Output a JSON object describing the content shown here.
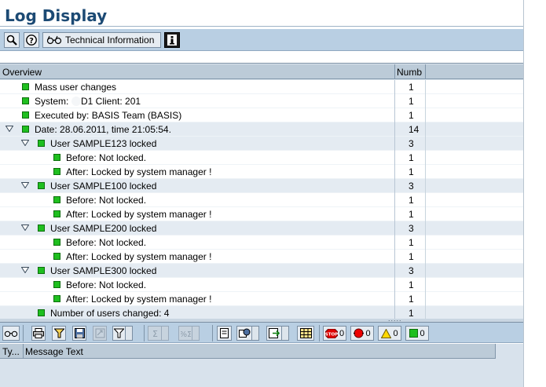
{
  "window": {
    "title": "Log Display"
  },
  "toolbar": {
    "technical_information_label": "Technical Information",
    "icons": [
      "find-icon",
      "help-icon",
      "glasses-icon",
      "info-icon"
    ]
  },
  "tree": {
    "columns": {
      "overview": "Overview",
      "number": "Numb"
    },
    "rows": [
      {
        "label": "Mass user changes",
        "count": "1",
        "level": 0,
        "expandable": false,
        "status": "green"
      },
      {
        "label": "System: ",
        "label_tail": "D1 Client: 201",
        "count": "1",
        "level": 0,
        "expandable": false,
        "status": "green"
      },
      {
        "label": "Executed by: BASIS Team (BASIS)",
        "count": "1",
        "level": 0,
        "expandable": false,
        "status": "green"
      },
      {
        "label": "Date: 28.06.2011, time 21:05:54.",
        "count": "14",
        "level": 0,
        "expandable": true,
        "status": "green"
      },
      {
        "label": "User SAMPLE123 locked",
        "count": "3",
        "level": 1,
        "expandable": true,
        "status": "green"
      },
      {
        "label": "Before:  Not locked.",
        "count": "1",
        "level": 2,
        "expandable": false,
        "status": "green"
      },
      {
        "label": "After:  Locked by system manager !",
        "count": "1",
        "level": 2,
        "expandable": false,
        "status": "green"
      },
      {
        "label": "User SAMPLE100 locked",
        "count": "3",
        "level": 1,
        "expandable": true,
        "status": "green"
      },
      {
        "label": "Before:  Not locked.",
        "count": "1",
        "level": 2,
        "expandable": false,
        "status": "green"
      },
      {
        "label": "After:  Locked by system manager !",
        "count": "1",
        "level": 2,
        "expandable": false,
        "status": "green"
      },
      {
        "label": "User SAMPLE200 locked",
        "count": "3",
        "level": 1,
        "expandable": true,
        "status": "green"
      },
      {
        "label": "Before:  Not locked.",
        "count": "1",
        "level": 2,
        "expandable": false,
        "status": "green"
      },
      {
        "label": "After:  Locked by system manager !",
        "count": "1",
        "level": 2,
        "expandable": false,
        "status": "green"
      },
      {
        "label": "User SAMPLE300 locked",
        "count": "3",
        "level": 1,
        "expandable": true,
        "status": "green"
      },
      {
        "label": "Before:  Not locked.",
        "count": "1",
        "level": 2,
        "expandable": false,
        "status": "green"
      },
      {
        "label": "After:  Locked by system manager !",
        "count": "1",
        "level": 2,
        "expandable": false,
        "status": "green"
      },
      {
        "label": "Number of users changed: 4",
        "count": "1",
        "level": 1,
        "expandable": false,
        "status": "green"
      }
    ]
  },
  "message_toolbar": {
    "counters": {
      "stop": "0",
      "error": "0",
      "warning": "0",
      "success": "0"
    }
  },
  "messages": {
    "columns": {
      "type": "Ty...",
      "text": "Message Text"
    },
    "rows": []
  },
  "colors": {
    "title": "#1c4a74",
    "toolbar_bg": "#b9cfe3",
    "status_green": "#1fbf1f"
  }
}
